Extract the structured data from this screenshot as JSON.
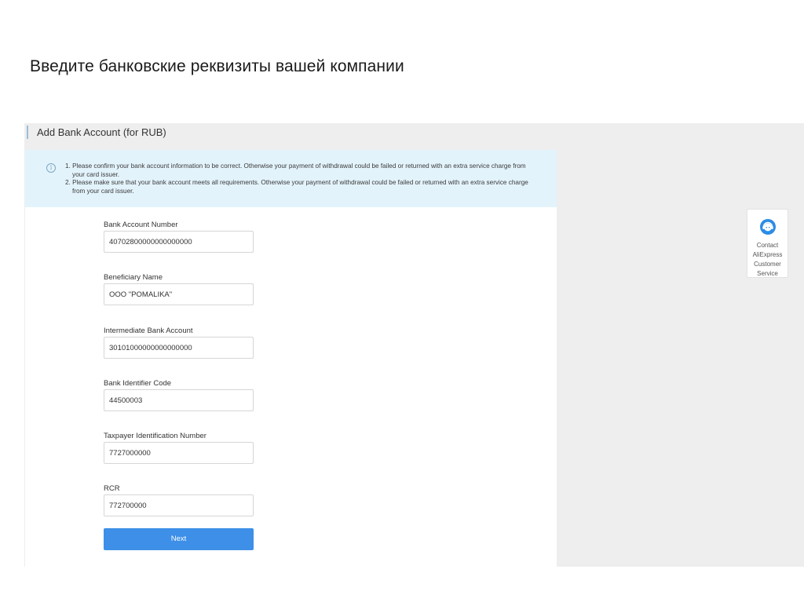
{
  "slide": {
    "title": "Введите банковские реквизиты вашей компании"
  },
  "page": {
    "heading": "Add Bank Account (for RUB)"
  },
  "notice": {
    "icon": "info-icon",
    "lines": [
      "1. Please confirm your bank account information to be correct. Otherwise your payment of withdrawal could be failed or returned with an extra service charge from",
      "your card issuer.",
      "2. Please make sure that your bank account meets all requirements. Otherwise your payment of withdrawal could be failed or returned with an extra service charge",
      "from your card issuer."
    ]
  },
  "form": {
    "fields": [
      {
        "label": "Bank Account Number",
        "value": "40702800000000000000"
      },
      {
        "label": "Beneficiary Name",
        "value": "OOO \"POMALIKA\""
      },
      {
        "label": "Intermediate Bank Account",
        "value": "30101000000000000000"
      },
      {
        "label": "Bank Identifier Code",
        "value": "44500003"
      },
      {
        "label": "Taxpayer Identification Number",
        "value": "7727000000"
      },
      {
        "label": "RCR",
        "value": "772700000"
      }
    ],
    "next_label": "Next"
  },
  "support": {
    "icon": "headset-icon",
    "lines": [
      "Contact",
      "AliExpress",
      "Customer",
      "Service"
    ]
  },
  "colors": {
    "accent": "#3d8fe8",
    "notice_bg": "#e3f3fb",
    "page_bg": "#eeeeee"
  }
}
